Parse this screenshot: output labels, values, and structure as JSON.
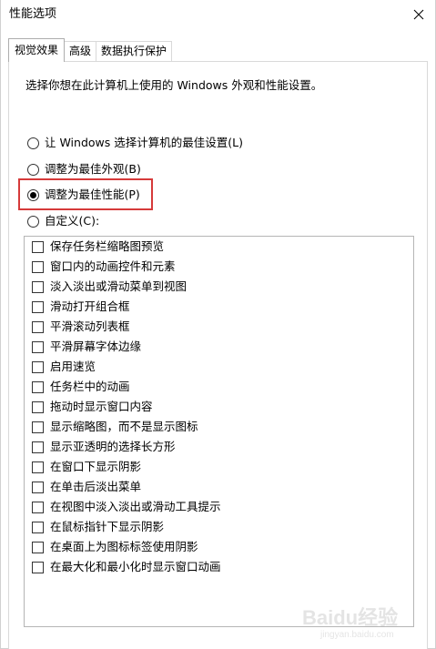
{
  "window": {
    "title": "性能选项"
  },
  "tabs": [
    {
      "label": "视觉效果",
      "active": true
    },
    {
      "label": "高级",
      "active": false
    },
    {
      "label": "数据执行保护",
      "active": false
    }
  ],
  "panel": {
    "description": "选择你想在此计算机上使用的 Windows 外观和性能设置。",
    "radios": [
      {
        "label": "让 Windows 选择计算机的最佳设置(L)",
        "selected": false
      },
      {
        "label": "调整为最佳外观(B)",
        "selected": false
      },
      {
        "label": "调整为最佳性能(P)",
        "selected": true
      },
      {
        "label": "自定义(C):",
        "selected": false
      }
    ],
    "highlight_color": "#d63a3a",
    "effects": [
      {
        "label": "保存任务栏缩略图预览",
        "checked": false
      },
      {
        "label": "窗口内的动画控件和元素",
        "checked": false
      },
      {
        "label": "淡入淡出或滑动菜单到视图",
        "checked": false
      },
      {
        "label": "滑动打开组合框",
        "checked": false
      },
      {
        "label": "平滑滚动列表框",
        "checked": false
      },
      {
        "label": "平滑屏幕字体边缘",
        "checked": false
      },
      {
        "label": "启用速览",
        "checked": false
      },
      {
        "label": "任务栏中的动画",
        "checked": false
      },
      {
        "label": "拖动时显示窗口内容",
        "checked": false
      },
      {
        "label": "显示缩略图，而不是显示图标",
        "checked": false
      },
      {
        "label": "显示亚透明的选择长方形",
        "checked": false
      },
      {
        "label": "在窗口下显示阴影",
        "checked": false
      },
      {
        "label": "在单击后淡出菜单",
        "checked": false
      },
      {
        "label": "在视图中淡入淡出或滑动工具提示",
        "checked": false
      },
      {
        "label": "在鼠标指针下显示阴影",
        "checked": false
      },
      {
        "label": "在桌面上为图标标签使用阴影",
        "checked": false
      },
      {
        "label": "在最大化和最小化时显示窗口动画",
        "checked": false
      }
    ]
  },
  "watermark": {
    "text": "Baidu经验",
    "subtext": "jingyan.baidu.com"
  }
}
